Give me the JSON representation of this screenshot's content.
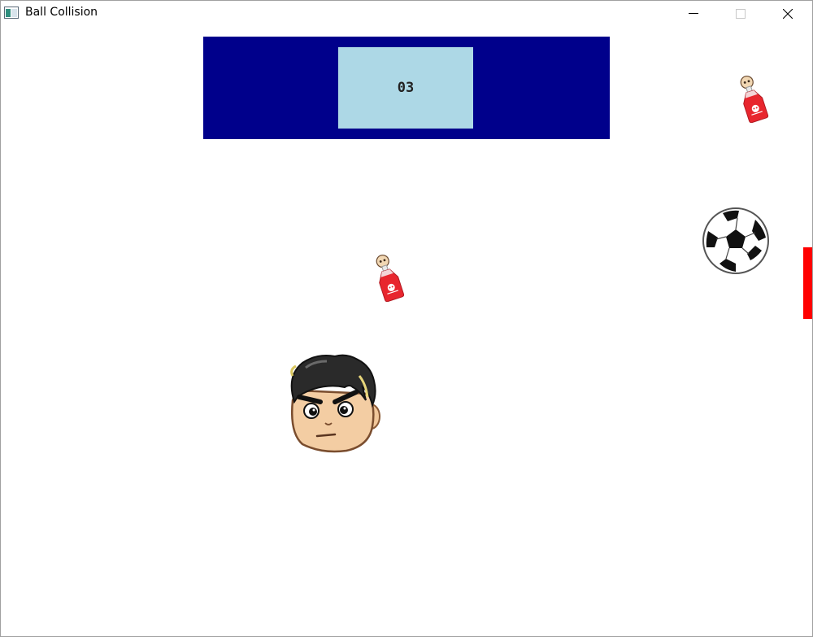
{
  "window": {
    "title": "Ball Collision",
    "icon": "app-window-icon",
    "controls": [
      "minimize-icon",
      "maximize-icon",
      "close-icon"
    ]
  },
  "hud": {
    "score": "03",
    "panel_color": "#00008b",
    "score_box_color": "#add8e6"
  },
  "sprites": {
    "poison_bottles": [
      "poison-bottle-icon",
      "poison-bottle-icon"
    ],
    "ball": "soccer-ball-icon",
    "player": "player-face-icon"
  },
  "paddle": {
    "color": "#ff0000"
  }
}
